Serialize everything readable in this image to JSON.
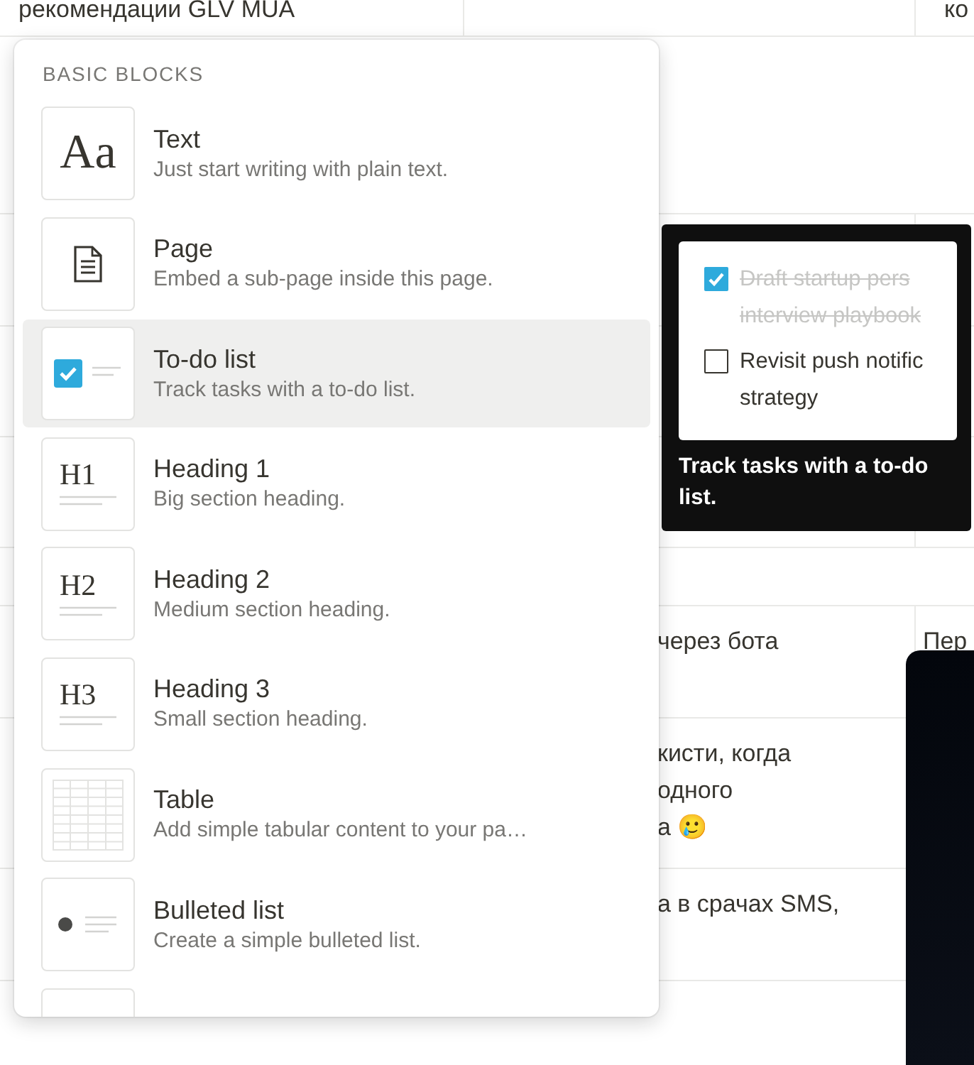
{
  "page": {
    "top_row": {
      "column_1": "рекомендации GLV MUA",
      "column_3": "ко"
    },
    "table_2": [
      {
        "column_2": "через бота",
        "column_3": "Пер"
      },
      {
        "column_2": "кисти, когда\nодного\nа 🥲"
      },
      {
        "column_2": "а в срачах SMS,"
      }
    ]
  },
  "block_menu": {
    "section_title": "BASIC BLOCKS",
    "items": [
      {
        "kind": "text",
        "icon_label": "Aa",
        "title": "Text",
        "description": "Just start writing with plain text.",
        "selected": false
      },
      {
        "kind": "page",
        "title": "Page",
        "description": "Embed a sub-page inside this page.",
        "selected": false
      },
      {
        "kind": "todo",
        "title": "To-do list",
        "description": "Track tasks with a to-do list.",
        "selected": true
      },
      {
        "kind": "heading",
        "icon_label": "H1",
        "title": "Heading 1",
        "description": "Big section heading.",
        "selected": false
      },
      {
        "kind": "heading",
        "icon_label": "H2",
        "title": "Heading 2",
        "description": "Medium section heading.",
        "selected": false
      },
      {
        "kind": "heading",
        "icon_label": "H3",
        "title": "Heading 3",
        "description": "Small section heading.",
        "selected": false
      },
      {
        "kind": "table",
        "title": "Table",
        "description": "Add simple tabular content to your pa…",
        "selected": false
      },
      {
        "kind": "bullet",
        "title": "Bulleted list",
        "description": "Create a simple bulleted list.",
        "selected": false
      },
      {
        "kind": "blank",
        "selected": false
      }
    ]
  },
  "tooltip": {
    "preview_items": [
      {
        "lines": [
          "Draft startup pers",
          "interview playbook"
        ],
        "checked": true
      },
      {
        "lines": [
          "Revisit push notific",
          "strategy"
        ],
        "checked": false
      }
    ],
    "caption": "Track tasks with a to-do list."
  }
}
